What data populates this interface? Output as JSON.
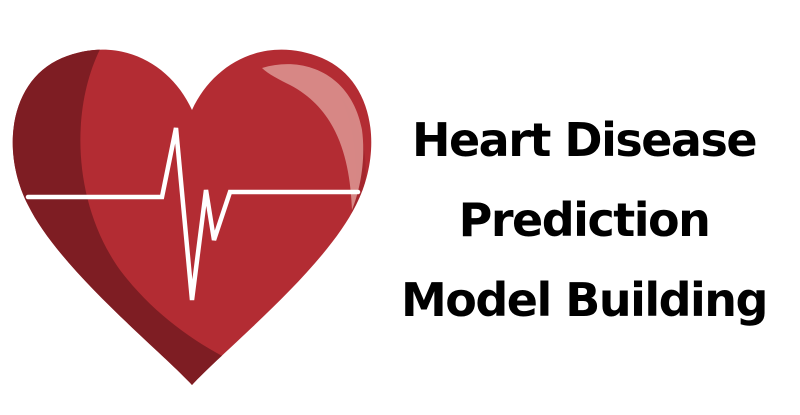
{
  "title": {
    "lines": [
      "Heart Disease",
      "Prediction",
      "Model Building"
    ]
  },
  "colors": {
    "background": "#ffffff",
    "heart_main": "#b32c33",
    "heart_shadow": "#7e1d23",
    "heart_highlight": "#d98c8a",
    "pulse_line": "#ffffff",
    "text": "#000000"
  },
  "icons": {
    "heart": "heart-icon",
    "pulse": "heartbeat-pulse-icon"
  }
}
